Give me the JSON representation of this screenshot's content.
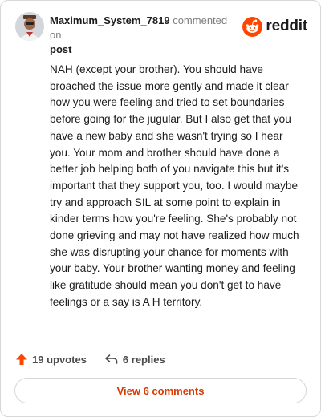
{
  "comment": {
    "username": "Maximum_System_7819",
    "action_text": " commented on",
    "post_link": "post",
    "body": "NAH (except your brother). You should have broached the issue more gently and made it clear how you were feeling and tried to set boundaries before going for the jugular. But I also get that you have a new baby and she wasn't trying so I hear you. Your mom and brother should have done a better job helping both of you navigate this but it's important that they support you, too. I would maybe try and approach SIL at some point to explain in kinder terms how you're feeling. She's probably not done grieving and may not have realized how much she was disrupting your chance for moments with your baby. Your brother wanting money and feeling like gratitude should mean you don't get to have feelings or a say is A H territory."
  },
  "brand": {
    "wordmark": "reddit",
    "icon": "reddit-snoo-icon",
    "color": "#ff4500"
  },
  "stats": {
    "upvotes_label": "19 upvotes",
    "upvote_icon": "upvote-arrow-icon",
    "upvote_color": "#ff4500",
    "replies_label": "6 replies",
    "reply_icon": "reply-arrow-icon"
  },
  "footer": {
    "view_comments_label": "View 6 comments",
    "accent": "#d93a00"
  }
}
